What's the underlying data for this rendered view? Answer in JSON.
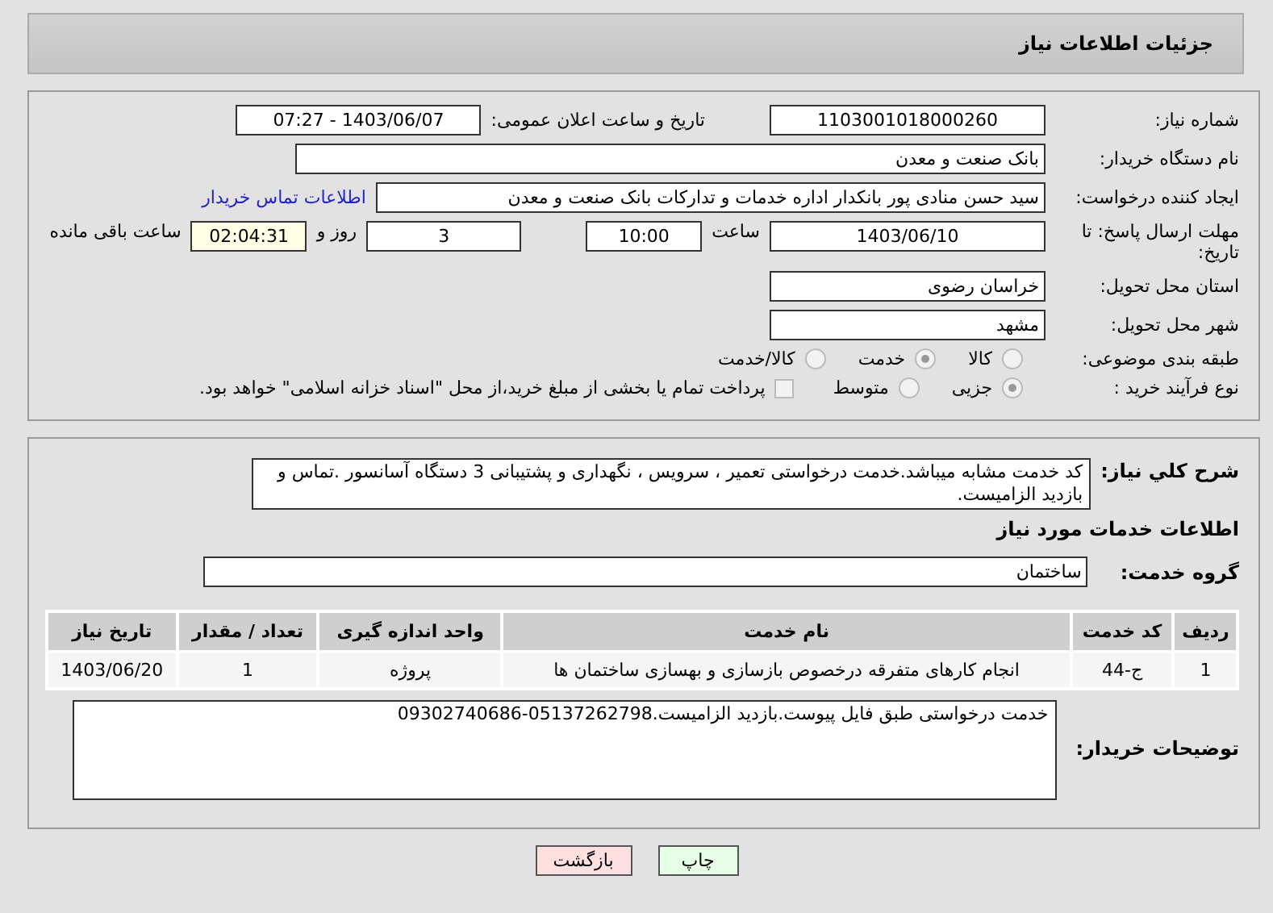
{
  "header": {
    "title": "جزئیات اطلاعات نیاز"
  },
  "details": {
    "need_number": {
      "label": "شماره نیاز:",
      "value": "1103001018000260"
    },
    "announce": {
      "label": "تاریخ و ساعت اعلان عمومی:",
      "value": "1403/06/07 - 07:27"
    },
    "buyer_org": {
      "label": "نام دستگاه خریدار:",
      "value": "بانک صنعت و معدن"
    },
    "requester": {
      "label": "ایجاد کننده درخواست:",
      "value": "سید حسن منادی پور بانکدار اداره خدمات و تدارکات بانک صنعت و معدن",
      "link": "اطلاعات تماس خریدار"
    },
    "deadline": {
      "label": "مهلت ارسال پاسخ: تا تاریخ:",
      "date": "1403/06/10",
      "time_label": "ساعت",
      "time": "10:00",
      "days": "3",
      "days_label": "روز و",
      "remaining": "02:04:31",
      "remaining_label": "ساعت باقی مانده"
    },
    "province": {
      "label": "استان محل تحویل:",
      "value": "خراسان رضوی"
    },
    "city": {
      "label": "شهر محل تحویل:",
      "value": "مشهد"
    },
    "category": {
      "label": "طبقه بندی موضوعی:",
      "options": [
        {
          "label": "کالا",
          "selected": false
        },
        {
          "label": "خدمت",
          "selected": true
        },
        {
          "label": "کالا/خدمت",
          "selected": false
        }
      ]
    },
    "process": {
      "label": "نوع فرآیند خرید :",
      "options": [
        {
          "label": "جزیی",
          "selected": true
        },
        {
          "label": "متوسط",
          "selected": false
        }
      ],
      "payment": {
        "checked": false,
        "label": "پرداخت تمام یا بخشی از مبلغ خرید،از محل \"اسناد خزانه اسلامی\" خواهد بود."
      }
    }
  },
  "needs": {
    "description": {
      "label": "شرح کلي نياز:",
      "value": "کد خدمت مشابه میباشد.خدمت درخواستی تعمیر ، سرویس ، نگهداری و پشتیبانی 3 دستگاه آسانسور .تماس و بازدید الزامیست."
    },
    "section_title": "اطلاعات خدمات مورد نیاز",
    "service_group": {
      "label": "گروه خدمت:",
      "value": "ساختمان"
    },
    "table": {
      "columns": [
        "ردیف",
        "کد خدمت",
        "نام خدمت",
        "واحد اندازه گیری",
        "تعداد / مقدار",
        "تاریخ نیاز"
      ],
      "rows": [
        [
          "1",
          "ج-44",
          "انجام کارهای متفرقه درخصوص بازسازی و بهسازی ساختمان ها",
          "پروژه",
          "1",
          "1403/06/20"
        ]
      ]
    },
    "buyer_notes": {
      "label": "توضیحات خریدار:",
      "value": "خدمت درخواستی طبق فایل پیوست.بازدید الزامیست.05137262798-09302740686"
    }
  },
  "buttons": [
    {
      "label": "چاپ",
      "kind": "print"
    },
    {
      "label": "بازگشت",
      "kind": "back"
    }
  ]
}
